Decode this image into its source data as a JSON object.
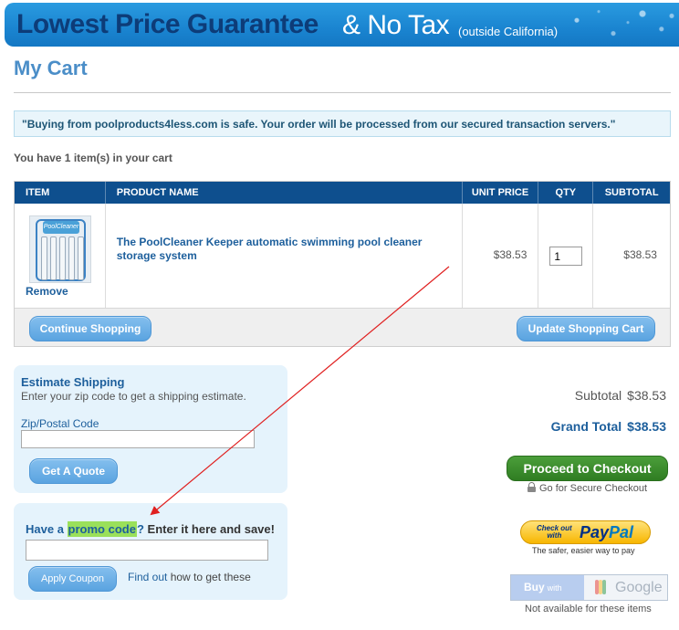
{
  "banner": {
    "headline": "Lowest Price Guarantee",
    "no_tax": "& No Tax",
    "outside": "(outside California)"
  },
  "page": {
    "title": "My Cart",
    "safe_message": "\"Buying from poolproducts4less.com is safe. Your order will be processed from our secured transaction servers.\"",
    "item_count_prefix": "You have ",
    "item_count": "1",
    "item_count_suffix": " item(s) in your cart"
  },
  "cart": {
    "headers": {
      "item": "ITEM",
      "name": "PRODUCT NAME",
      "unit_price": "UNIT PRICE",
      "qty": "QTY",
      "subtotal": "SUBTOTAL"
    },
    "row": {
      "thumb_label": "PoolCleaner",
      "remove": "Remove",
      "name": "The PoolCleaner Keeper automatic swimming pool cleaner storage system",
      "unit_price": "$38.53",
      "qty": "1",
      "subtotal": "$38.53"
    },
    "continue_label": "Continue Shopping",
    "update_label": "Update Shopping Cart"
  },
  "shipping": {
    "title": "Estimate Shipping",
    "subtitle": "Enter your zip code to get a shipping estimate.",
    "zip_label": "Zip/Postal Code",
    "zip_value": "",
    "quote_label": "Get A Quote"
  },
  "promo": {
    "have_a": "Have a ",
    "promo_code": "promo code",
    "question": "?",
    "enter": " Enter it here and save!",
    "code_value": "",
    "apply_label": "Apply Coupon",
    "find_out": "Find out",
    "how_to": " how to get these"
  },
  "totals": {
    "subtotal_label": "Subtotal",
    "subtotal_value": "$38.53",
    "grand_label": "Grand Total",
    "grand_value": "$38.53"
  },
  "checkout": {
    "proceed_label": "Proceed to Checkout",
    "secure_label": "Go for Secure Checkout",
    "paypal_check": "Check out",
    "paypal_with": "with",
    "paypal_brand_a": "Pay",
    "paypal_brand_b": "Pal",
    "paypal_tagline": "The safer, easier way to pay",
    "google_buy": "Buy",
    "google_with": "with",
    "google_brand": "Google",
    "google_note": "Not available for these items"
  },
  "colors": {
    "accent_blue": "#1d5f9c",
    "header_navy": "#0e4f8e",
    "checkout_green": "#2f7d22",
    "promo_highlight": "#9ae05a",
    "annotation_red": "#e02020"
  }
}
